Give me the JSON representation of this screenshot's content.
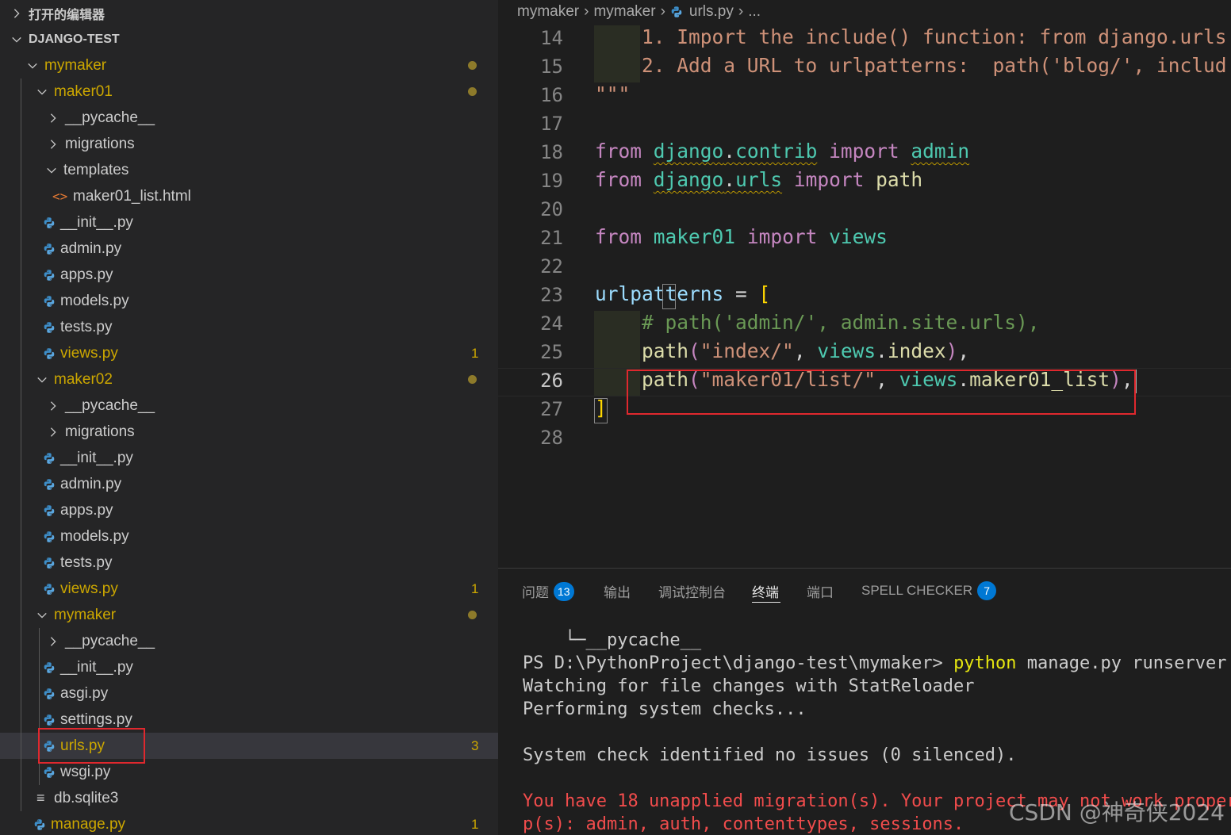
{
  "sidebar": {
    "open_editors_label": "打开的编辑器",
    "project_label": "DJANGO-TEST",
    "items": [
      {
        "label": "mymaker",
        "kind": "folder-open",
        "depth": 1,
        "modified": true,
        "badge": "dot"
      },
      {
        "label": "maker01",
        "kind": "folder-open",
        "depth": 2,
        "modified": true,
        "badge": "dot"
      },
      {
        "label": "__pycache__",
        "kind": "folder-closed",
        "depth": 3
      },
      {
        "label": "migrations",
        "kind": "folder-closed",
        "depth": 3
      },
      {
        "label": "templates",
        "kind": "folder-open",
        "depth": 3
      },
      {
        "label": "maker01_list.html",
        "kind": "html",
        "depth": 4
      },
      {
        "label": "__init__.py",
        "kind": "py",
        "depth": 3
      },
      {
        "label": "admin.py",
        "kind": "py",
        "depth": 3
      },
      {
        "label": "apps.py",
        "kind": "py",
        "depth": 3
      },
      {
        "label": "models.py",
        "kind": "py",
        "depth": 3
      },
      {
        "label": "tests.py",
        "kind": "py",
        "depth": 3
      },
      {
        "label": "views.py",
        "kind": "py",
        "depth": 3,
        "modified": true,
        "badge": "1"
      },
      {
        "label": "maker02",
        "kind": "folder-open",
        "depth": 2,
        "modified": true,
        "badge": "dot"
      },
      {
        "label": "__pycache__",
        "kind": "folder-closed",
        "depth": 3
      },
      {
        "label": "migrations",
        "kind": "folder-closed",
        "depth": 3
      },
      {
        "label": "__init__.py",
        "kind": "py",
        "depth": 3
      },
      {
        "label": "admin.py",
        "kind": "py",
        "depth": 3
      },
      {
        "label": "apps.py",
        "kind": "py",
        "depth": 3
      },
      {
        "label": "models.py",
        "kind": "py",
        "depth": 3
      },
      {
        "label": "tests.py",
        "kind": "py",
        "depth": 3
      },
      {
        "label": "views.py",
        "kind": "py",
        "depth": 3,
        "modified": true,
        "badge": "1"
      },
      {
        "label": "mymaker",
        "kind": "folder-open",
        "depth": 2,
        "modified": true,
        "badge": "dot"
      },
      {
        "label": "__pycache__",
        "kind": "folder-closed",
        "depth": 3
      },
      {
        "label": "__init__.py",
        "kind": "py",
        "depth": 3
      },
      {
        "label": "asgi.py",
        "kind": "py",
        "depth": 3
      },
      {
        "label": "settings.py",
        "kind": "py",
        "depth": 3
      },
      {
        "label": "urls.py",
        "kind": "py",
        "depth": 3,
        "modified": true,
        "badge": "3",
        "selected": true
      },
      {
        "label": "wsgi.py",
        "kind": "py",
        "depth": 3
      },
      {
        "label": "db.sqlite3",
        "kind": "db",
        "depth": 2
      },
      {
        "label": "manage.py",
        "kind": "py",
        "depth": 2,
        "modified": true,
        "badge": "1"
      }
    ]
  },
  "breadcrumb": [
    "mymaker",
    "mymaker",
    "urls.py",
    "..."
  ],
  "editor": {
    "active_line": "26",
    "lines": [
      {
        "n": "14",
        "tokens": [
          {
            "t": "    1. Import the include() function: from django.urls",
            "c": "str"
          }
        ]
      },
      {
        "n": "15",
        "tokens": [
          {
            "t": "    2. Add a URL to urlpatterns:  path('blog/', includ",
            "c": "str"
          }
        ]
      },
      {
        "n": "16",
        "tokens": [
          {
            "t": "\"\"\"",
            "c": "str"
          }
        ]
      },
      {
        "n": "17",
        "tokens": []
      },
      {
        "n": "18",
        "tokens": [
          {
            "t": "from",
            "c": "kw"
          },
          {
            "t": " "
          },
          {
            "t": "django",
            "c": "mod-name squig"
          },
          {
            "t": ".",
            "c": "squig"
          },
          {
            "t": "contrib",
            "c": "mod-name squig"
          },
          {
            "t": " "
          },
          {
            "t": "import",
            "c": "kw"
          },
          {
            "t": " "
          },
          {
            "t": "admin",
            "c": "mod-name squig"
          }
        ]
      },
      {
        "n": "19",
        "tokens": [
          {
            "t": "from",
            "c": "kw"
          },
          {
            "t": " "
          },
          {
            "t": "django",
            "c": "mod-name squig"
          },
          {
            "t": ".",
            "c": "squig"
          },
          {
            "t": "urls",
            "c": "mod-name squig"
          },
          {
            "t": " "
          },
          {
            "t": "import",
            "c": "kw"
          },
          {
            "t": " "
          },
          {
            "t": "path",
            "c": "fn"
          }
        ]
      },
      {
        "n": "20",
        "tokens": []
      },
      {
        "n": "21",
        "tokens": [
          {
            "t": "from",
            "c": "kw"
          },
          {
            "t": " "
          },
          {
            "t": "maker01",
            "c": "mod-name"
          },
          {
            "t": " "
          },
          {
            "t": "import",
            "c": "kw"
          },
          {
            "t": " "
          },
          {
            "t": "views",
            "c": "mod-name"
          }
        ]
      },
      {
        "n": "22",
        "tokens": []
      },
      {
        "n": "23",
        "tokens": [
          {
            "t": "urlpatterns",
            "c": "var"
          },
          {
            "t": " = "
          },
          {
            "t": "[",
            "c": "bracket"
          }
        ]
      },
      {
        "n": "24",
        "tokens": [
          {
            "t": "    "
          },
          {
            "t": "# path('admin/', admin.site.urls),",
            "c": "com"
          }
        ]
      },
      {
        "n": "25",
        "tokens": [
          {
            "t": "    "
          },
          {
            "t": "path",
            "c": "fn"
          },
          {
            "t": "(",
            "c": "kw"
          },
          {
            "t": "\"index/\"",
            "c": "str"
          },
          {
            "t": ", "
          },
          {
            "t": "views",
            "c": "mod-name"
          },
          {
            "t": "."
          },
          {
            "t": "index",
            "c": "fn"
          },
          {
            "t": ")",
            "c": "kw"
          },
          {
            "t": ","
          }
        ]
      },
      {
        "n": "26",
        "tokens": [
          {
            "t": "    "
          },
          {
            "t": "path",
            "c": "fn"
          },
          {
            "t": "(",
            "c": "kw"
          },
          {
            "t": "\"maker01/list/\"",
            "c": "str"
          },
          {
            "t": ", "
          },
          {
            "t": "views",
            "c": "mod-name"
          },
          {
            "t": "."
          },
          {
            "t": "maker01_list",
            "c": "fn"
          },
          {
            "t": ")",
            "c": "kw"
          },
          {
            "t": ","
          }
        ]
      },
      {
        "n": "27",
        "tokens": [
          {
            "t": "]",
            "c": "bracket"
          }
        ]
      },
      {
        "n": "28",
        "tokens": []
      }
    ]
  },
  "panel": {
    "tabs": [
      {
        "label": "问题",
        "badge": "13"
      },
      {
        "label": "输出"
      },
      {
        "label": "调试控制台"
      },
      {
        "label": "终端",
        "active": true
      },
      {
        "label": "端口"
      },
      {
        "label": "SPELL CHECKER",
        "badge": "7"
      }
    ],
    "terminal": {
      "tree_line": "    └─__pycache__",
      "prompt": "PS D:\\PythonProject\\django-test\\mymaker> ",
      "cmd_python": "python",
      "cmd_rest": " manage.py runserver",
      "line_watching": "Watching for file changes with StatReloader",
      "line_performing": "Performing system checks...",
      "line_check": "System check identified no issues (0 silenced).",
      "line_migr1": "You have 18 unapplied migration(s). Your project may not work properl",
      "line_migr2": "p(s): admin, auth, contenttypes, sessions."
    }
  },
  "watermark": "CSDN @神奇侠2024"
}
